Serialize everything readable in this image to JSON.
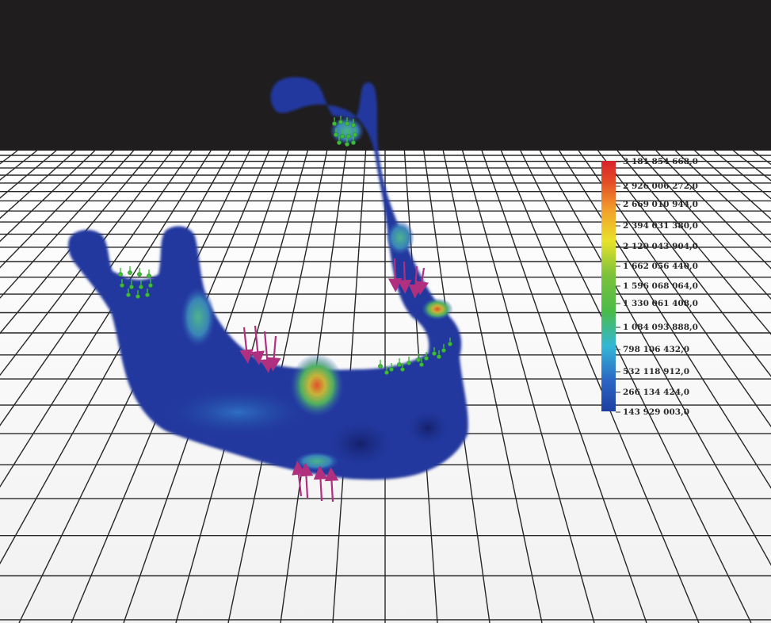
{
  "scene": {
    "background_color": "#1f1d1e",
    "floor_color": "#f7f7f7",
    "grid_color": "#262626",
    "model": "mandible-fea-stress-model",
    "model_color": "#20389e"
  },
  "legend": {
    "type": "color-scale",
    "gradient_colors": [
      "#1d3fa0",
      "#2a64c4",
      "#33b7d6",
      "#49bb48",
      "#7fc23a",
      "#e8e22a",
      "#f2a12b",
      "#e34a26",
      "#d8222b"
    ],
    "labels": [
      "3 181 854 668,0",
      "2 926 006 272,0",
      "2 669 010 944,0",
      "2 394 031 380,0",
      "2 120 043 904,0",
      "1 662 056 440,0",
      "1 596 068 064,0",
      "1 330 061 408,0",
      "1 084 093 888,0",
      "798 106 432,0",
      "532 118 912,0",
      "266 134 424,0",
      "143 929 003,0"
    ]
  },
  "loads": {
    "force_arrow_color": "#b0307f",
    "constraint_color": "#3fbb3a"
  }
}
